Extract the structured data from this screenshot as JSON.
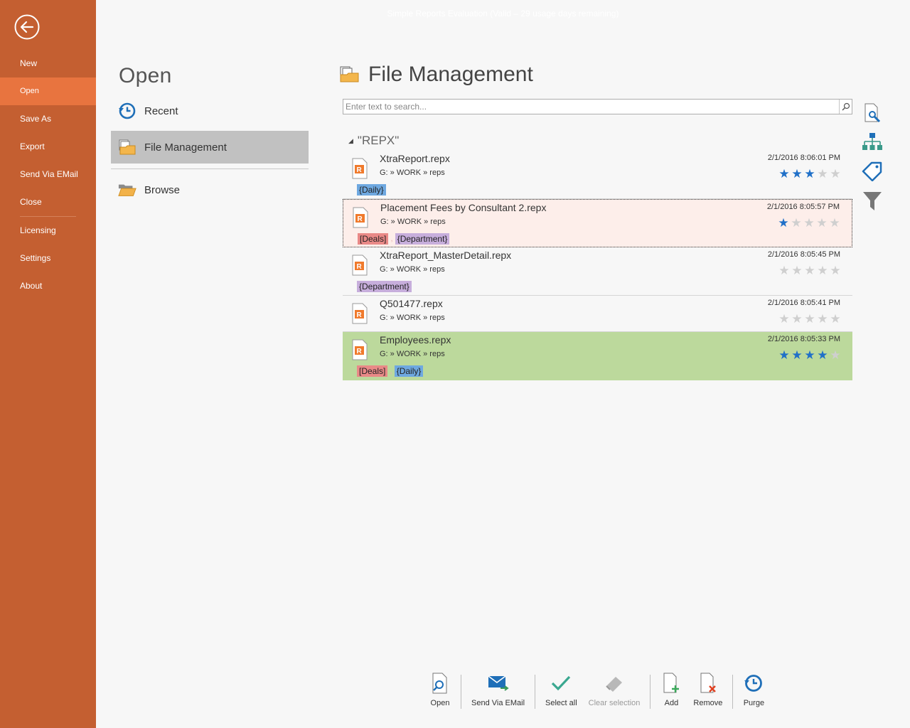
{
  "window": {
    "title": "Simple Reports Evaluation (Valid – 29 usage days remaining)"
  },
  "sidebar": {
    "items": [
      {
        "label": "New"
      },
      {
        "label": "Open"
      },
      {
        "label": "Save As"
      },
      {
        "label": "Export"
      },
      {
        "label": "Send Via EMail"
      },
      {
        "label": "Close"
      },
      {
        "label": "Licensing"
      },
      {
        "label": "Settings"
      },
      {
        "label": "About"
      }
    ],
    "active": "Open",
    "bg_color": "#c45f31",
    "active_color": "#e8743f"
  },
  "open_panel": {
    "title": "Open",
    "places": [
      {
        "label": "Recent",
        "icon": "recent-clock-icon"
      },
      {
        "label": "File Management",
        "icon": "file-management-icon"
      },
      {
        "label": "Browse",
        "icon": "folder-icon"
      }
    ]
  },
  "file_management": {
    "title": "File Management",
    "search_placeholder": "Enter text to search...",
    "group_label": "\"REPX\"",
    "files": [
      {
        "name": "XtraReport.repx",
        "path": "G: » WORK » reps",
        "date": "2/1/2016 8:06:01 PM",
        "rating": 3,
        "tags": [
          "{Daily}"
        ]
      },
      {
        "name": "Placement Fees by Consultant 2.repx",
        "path": "G: » WORK » reps",
        "date": "2/1/2016 8:05:57 PM",
        "rating": 1,
        "tags": [
          "[Deals]",
          "{Department}"
        ]
      },
      {
        "name": "XtraReport_MasterDetail.repx",
        "path": "G: » WORK » reps",
        "date": "2/1/2016 8:05:45 PM",
        "rating": 0,
        "tags": [
          "{Department}"
        ]
      },
      {
        "name": "Q501477.repx",
        "path": "G: » WORK » reps",
        "date": "2/1/2016 8:05:41 PM",
        "rating": 0,
        "tags": []
      },
      {
        "name": "Employees.repx",
        "path": "G: » WORK » reps",
        "date": "2/1/2016 8:05:33 PM",
        "rating": 4,
        "tags": [
          "[Deals]",
          "{Daily}"
        ]
      }
    ],
    "tag_separator": ",",
    "side_tools": [
      "report-settings-icon",
      "hierarchy-icon",
      "tag-icon",
      "filter-icon"
    ]
  },
  "toolbar": {
    "open": "Open",
    "send_email": "Send Via EMail",
    "select_all": "Select all",
    "clear_selection": "Clear selection",
    "add": "Add",
    "remove": "Remove",
    "purge": "Purge"
  }
}
